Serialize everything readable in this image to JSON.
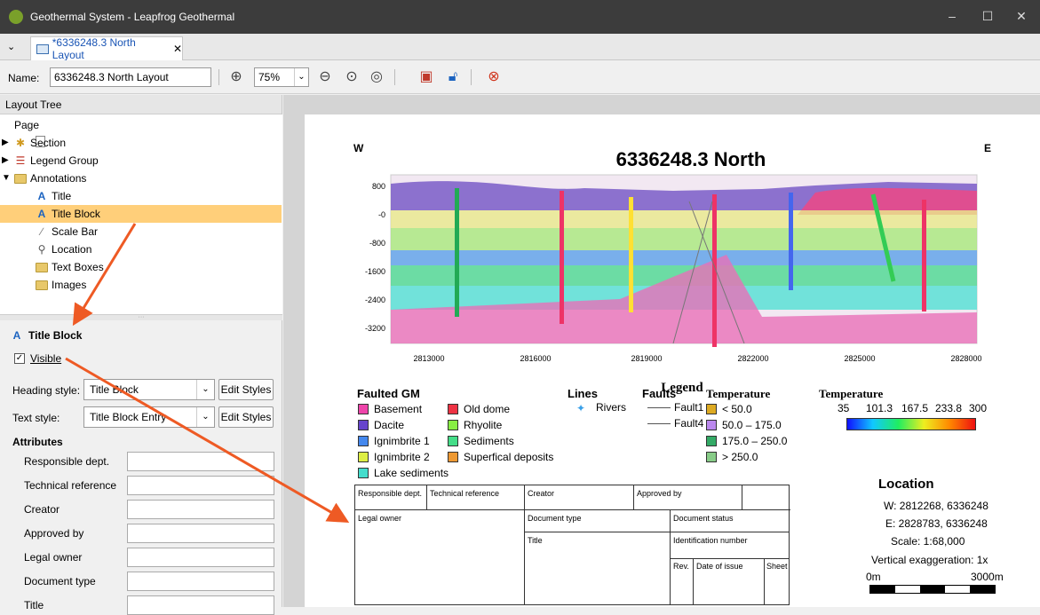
{
  "window": {
    "title": "Geothermal System - Leapfrog Geothermal"
  },
  "tab": {
    "label": "*6336248.3 North Layout"
  },
  "toolbar": {
    "name_label": "Name:",
    "name_value": "6336248.3 North Layout",
    "zoom": "75%"
  },
  "layout_tree": {
    "header": "Layout Tree",
    "items": [
      {
        "label": "Page"
      },
      {
        "label": "Section"
      },
      {
        "label": "Legend Group"
      },
      {
        "label": "Annotations"
      },
      {
        "label": "Title"
      },
      {
        "label": "Title Block"
      },
      {
        "label": "Scale Bar"
      },
      {
        "label": "Location"
      },
      {
        "label": "Text Boxes"
      },
      {
        "label": "Images"
      }
    ]
  },
  "properties": {
    "title": "Title Block",
    "visible_label": "Visible",
    "heading_style_label": "Heading style:",
    "heading_style_value": "Title Block",
    "text_style_label": "Text style:",
    "text_style_value": "Title Block Entry",
    "edit_styles": "Edit Styles",
    "attributes_label": "Attributes",
    "attributes": [
      "Responsible dept.",
      "Technical reference",
      "Creator",
      "Approved by",
      "Legal owner",
      "Document type",
      "Title"
    ]
  },
  "section": {
    "title": "6336248.3 North",
    "west": "W",
    "east": "E",
    "y_ticks": [
      "800",
      "-0",
      "-800",
      "-1600",
      "-2400",
      "-3200"
    ],
    "x_ticks": [
      "2813000",
      "2816000",
      "2819000",
      "2822000",
      "2825000",
      "2828000"
    ]
  },
  "legend": {
    "title": "Legend",
    "faulted_title": "Faulted GM",
    "units": [
      {
        "name": "Basement",
        "color": "#ee44aa"
      },
      {
        "name": "Old dome",
        "color": "#ee3344"
      },
      {
        "name": "Dacite",
        "color": "#6644cc"
      },
      {
        "name": "Rhyolite",
        "color": "#88ee44"
      },
      {
        "name": "Ignimbrite 1",
        "color": "#4488ee"
      },
      {
        "name": "Sediments",
        "color": "#44dd88"
      },
      {
        "name": "Ignimbrite 2",
        "color": "#ddee44"
      },
      {
        "name": "Superfical deposits",
        "color": "#ee9933"
      },
      {
        "name": "Lake sediments",
        "color": "#44ddcc"
      }
    ],
    "lines_title": "Lines",
    "lines_item": "Rivers",
    "faults_title": "Faults",
    "faults": [
      "Fault1",
      "Fault4"
    ],
    "temp_title": "Temperature",
    "temp_classes": [
      {
        "label": "< 50.0",
        "color": "#ddaa22"
      },
      {
        "label": "50.0 – 175.0",
        "color": "#bb88ee"
      },
      {
        "label": "175.0 – 250.0",
        "color": "#33aa66"
      },
      {
        "label": "> 250.0",
        "color": "#88cc88"
      }
    ],
    "temp2_title": "Temperature",
    "temp_scale": [
      "35",
      "101.3",
      "167.5",
      "233.8",
      "300"
    ]
  },
  "location": {
    "title": "Location",
    "west": "W:  2812268, 6336248",
    "east": "E:  2828783, 6336248",
    "scale": "Scale: 1:68,000",
    "vert": "Vertical exaggeration: 1x",
    "bar_start": "0m",
    "bar_end": "3000m"
  },
  "title_block": {
    "responsible": "Responsible dept.",
    "technical": "Technical reference",
    "creator": "Creator",
    "approved": "Approved by",
    "legal": "Legal owner",
    "doctype": "Document type",
    "docstatus": "Document status",
    "title": "Title",
    "idnum": "Identification number",
    "rev": "Rev.",
    "date": "Date of issue",
    "sheet": "Sheet"
  }
}
